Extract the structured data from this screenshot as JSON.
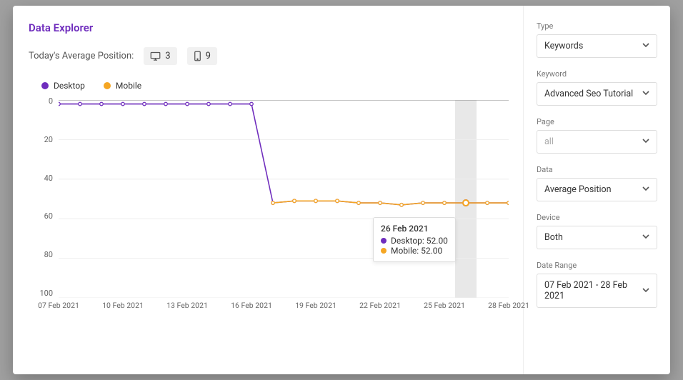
{
  "title": "Data Explorer",
  "avgLabel": "Today's Average Position:",
  "badges": {
    "desktop": "3",
    "mobile": "9"
  },
  "legend": {
    "desktop": {
      "label": "Desktop",
      "color": "#6f2dbd"
    },
    "mobile": {
      "label": "Mobile",
      "color": "#f5a623"
    }
  },
  "tooltip": {
    "date": "26 Feb 2021",
    "rows": [
      {
        "label": "Desktop",
        "value": "52.00",
        "color": "#6f2dbd"
      },
      {
        "label": "Mobile",
        "value": "52.00",
        "color": "#f5a623"
      }
    ]
  },
  "sidebar": {
    "type": {
      "label": "Type",
      "value": "Keywords"
    },
    "keyword": {
      "label": "Keyword",
      "value": "Advanced Seo Tutorial"
    },
    "page": {
      "label": "Page",
      "value": "all",
      "placeholder": true
    },
    "data": {
      "label": "Data",
      "value": "Average Position"
    },
    "device": {
      "label": "Device",
      "value": "Both"
    },
    "range": {
      "label": "Date Range",
      "value": "07 Feb 2021 - 28 Feb 2021"
    }
  },
  "chart_data": {
    "type": "line",
    "title": "",
    "xlabel": "",
    "ylabel": "",
    "ylim": [
      0,
      100
    ],
    "y_reversed": true,
    "x": [
      "07 Feb 2021",
      "08 Feb 2021",
      "09 Feb 2021",
      "10 Feb 2021",
      "11 Feb 2021",
      "12 Feb 2021",
      "13 Feb 2021",
      "14 Feb 2021",
      "15 Feb 2021",
      "16 Feb 2021",
      "17 Feb 2021",
      "18 Feb 2021",
      "19 Feb 2021",
      "20 Feb 2021",
      "21 Feb 2021",
      "22 Feb 2021",
      "23 Feb 2021",
      "24 Feb 2021",
      "25 Feb 2021",
      "26 Feb 2021",
      "27 Feb 2021",
      "28 Feb 2021"
    ],
    "x_ticks": [
      "07 Feb 2021",
      "10 Feb 2021",
      "13 Feb 2021",
      "16 Feb 2021",
      "19 Feb 2021",
      "22 Feb 2021",
      "25 Feb 2021",
      "28 Feb 2021"
    ],
    "y_ticks": [
      0,
      20,
      40,
      60,
      80,
      100
    ],
    "series": [
      {
        "name": "Desktop",
        "color": "#6f2dbd",
        "values": [
          2,
          2,
          2,
          2,
          2,
          2,
          2,
          2,
          2,
          2,
          52,
          51,
          51,
          51,
          52,
          52,
          53,
          52,
          52,
          52,
          52,
          52
        ]
      },
      {
        "name": "Mobile",
        "color": "#f5a623",
        "values": [
          null,
          null,
          null,
          null,
          null,
          null,
          null,
          null,
          null,
          null,
          52,
          51,
          51,
          51,
          52,
          52,
          53,
          52,
          52,
          52,
          52,
          52
        ]
      }
    ],
    "highlight_x": "26 Feb 2021"
  }
}
